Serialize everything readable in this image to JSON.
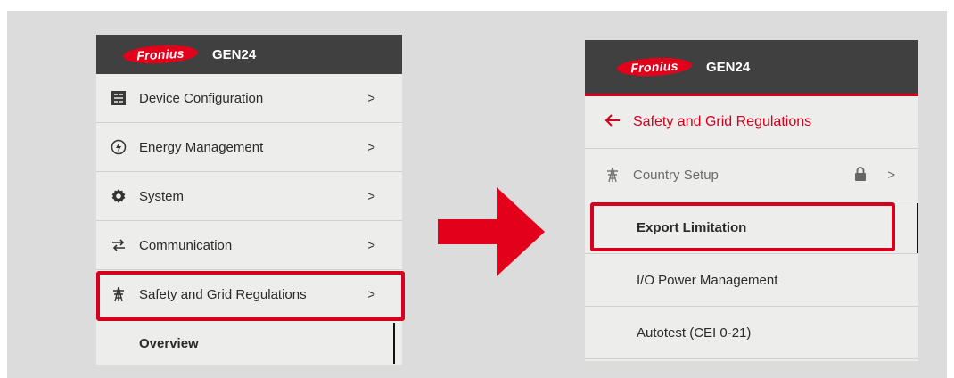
{
  "left_panel": {
    "logo_text": "Fronius",
    "product": "GEN24",
    "menu_items": [
      {
        "label": "Device Configuration",
        "icon": "device-config-icon"
      },
      {
        "label": "Energy Management",
        "icon": "energy-icon"
      },
      {
        "label": "System",
        "icon": "gear-icon"
      },
      {
        "label": "Communication",
        "icon": "transfer-arrows-icon"
      },
      {
        "label": "Safety and Grid Regulations",
        "icon": "grid-pylon-icon"
      }
    ],
    "sub_item": "Overview",
    "chevron": ">"
  },
  "right_panel": {
    "logo_text": "Fronius",
    "product": "GEN24",
    "back_label": "Safety and Grid Regulations",
    "items": [
      {
        "label": "Country Setup",
        "icon": "grid-pylon-icon",
        "locked": true
      },
      {
        "label": "Export Limitation"
      },
      {
        "label": "I/O Power Management"
      },
      {
        "label": "Autotest (CEI 0-21)"
      }
    ],
    "chevron": ">"
  },
  "colors": {
    "accent": "#d4001e",
    "header": "#404040",
    "panel": "#ededec",
    "background": "#dcdcdc"
  }
}
